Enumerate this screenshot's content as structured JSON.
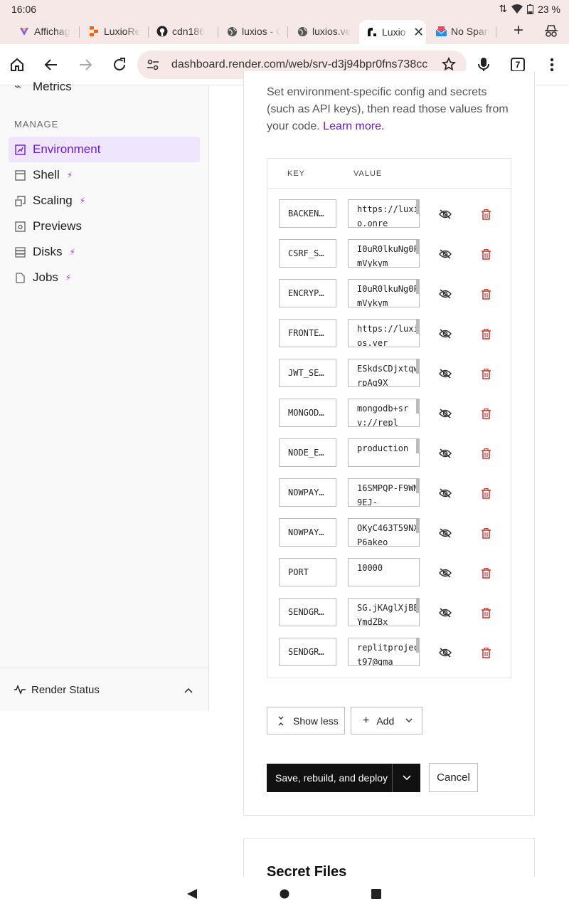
{
  "status_bar": {
    "time": "16:06",
    "battery": "23 %"
  },
  "tabs": [
    {
      "label": "Affichag",
      "icon": "affichage-logo-icon"
    },
    {
      "label": "LuxioRe",
      "icon": "replit-icon"
    },
    {
      "label": "cdn186",
      "icon": "github-icon"
    },
    {
      "label": "luxios - C",
      "icon": "globe-icon"
    },
    {
      "label": "luxios.ve",
      "icon": "globe-icon"
    },
    {
      "label": "Luxio",
      "icon": "render-logo-icon",
      "active": true
    },
    {
      "label": "No Spam",
      "icon": "mail-icon"
    }
  ],
  "tab_count": "7",
  "address_bar": {
    "url": "dashboard.render.com/web/srv-d3j94bpr0fns738cc"
  },
  "sidebar": {
    "partial_item": "Metrics",
    "section_label": "MANAGE",
    "items": [
      {
        "label": "Environment",
        "icon": "environment-icon",
        "active": true,
        "premium": false
      },
      {
        "label": "Shell",
        "icon": "shell-icon",
        "premium": true
      },
      {
        "label": "Scaling",
        "icon": "scaling-icon",
        "premium": true
      },
      {
        "label": "Previews",
        "icon": "previews-icon",
        "premium": false
      },
      {
        "label": "Disks",
        "icon": "disks-icon",
        "premium": true
      },
      {
        "label": "Jobs",
        "icon": "jobs-icon",
        "premium": true
      }
    ],
    "render_status": "Render Status"
  },
  "main": {
    "description": "Set environment-specific config and secrets (such as API keys), then read those values from your code.",
    "learn_more": "Learn more.",
    "table": {
      "key_header": "KEY",
      "value_header": "VALUE",
      "rows": [
        {
          "key": "BACKEN…",
          "value": "https://luxio.onre"
        },
        {
          "key": "CSRF_S…",
          "value": "I0uR0lkuNg0PmVykym"
        },
        {
          "key": "ENCRYP…",
          "value": "I0uR0lkuNg0PmVykym"
        },
        {
          "key": "FRONTE…",
          "value": "https://luxios.ver"
        },
        {
          "key": "JWT_SE…",
          "value": "ESkdsCDjxtqwrpAg9X"
        },
        {
          "key": "MONGOD…",
          "value": "mongodb+srv://repl"
        },
        {
          "key": "NODE_E…",
          "value": "production"
        },
        {
          "key": "NOWPAY…",
          "value": "16SMPQP-F9WM9EJ-"
        },
        {
          "key": "NOWPAY…",
          "value": "OKyC463T59NXP6akeo"
        },
        {
          "key": "PORT",
          "value": "10000"
        },
        {
          "key": "SENDGR…",
          "value": "SG.jKAglXjBBYmdZBx"
        },
        {
          "key": "SENDGR…",
          "value": "replitproject97@gma"
        }
      ]
    },
    "show_less": "Show less",
    "add": "Add",
    "save_deploy": "Save, rebuild, and deploy",
    "cancel": "Cancel",
    "secret_files_title": "Secret Files"
  },
  "colors": {
    "accent": "#6a1bd1",
    "premium_bolt": "#d228ff",
    "delete_red": "#c0392b",
    "chrome_bg": "#f6e8e6"
  }
}
